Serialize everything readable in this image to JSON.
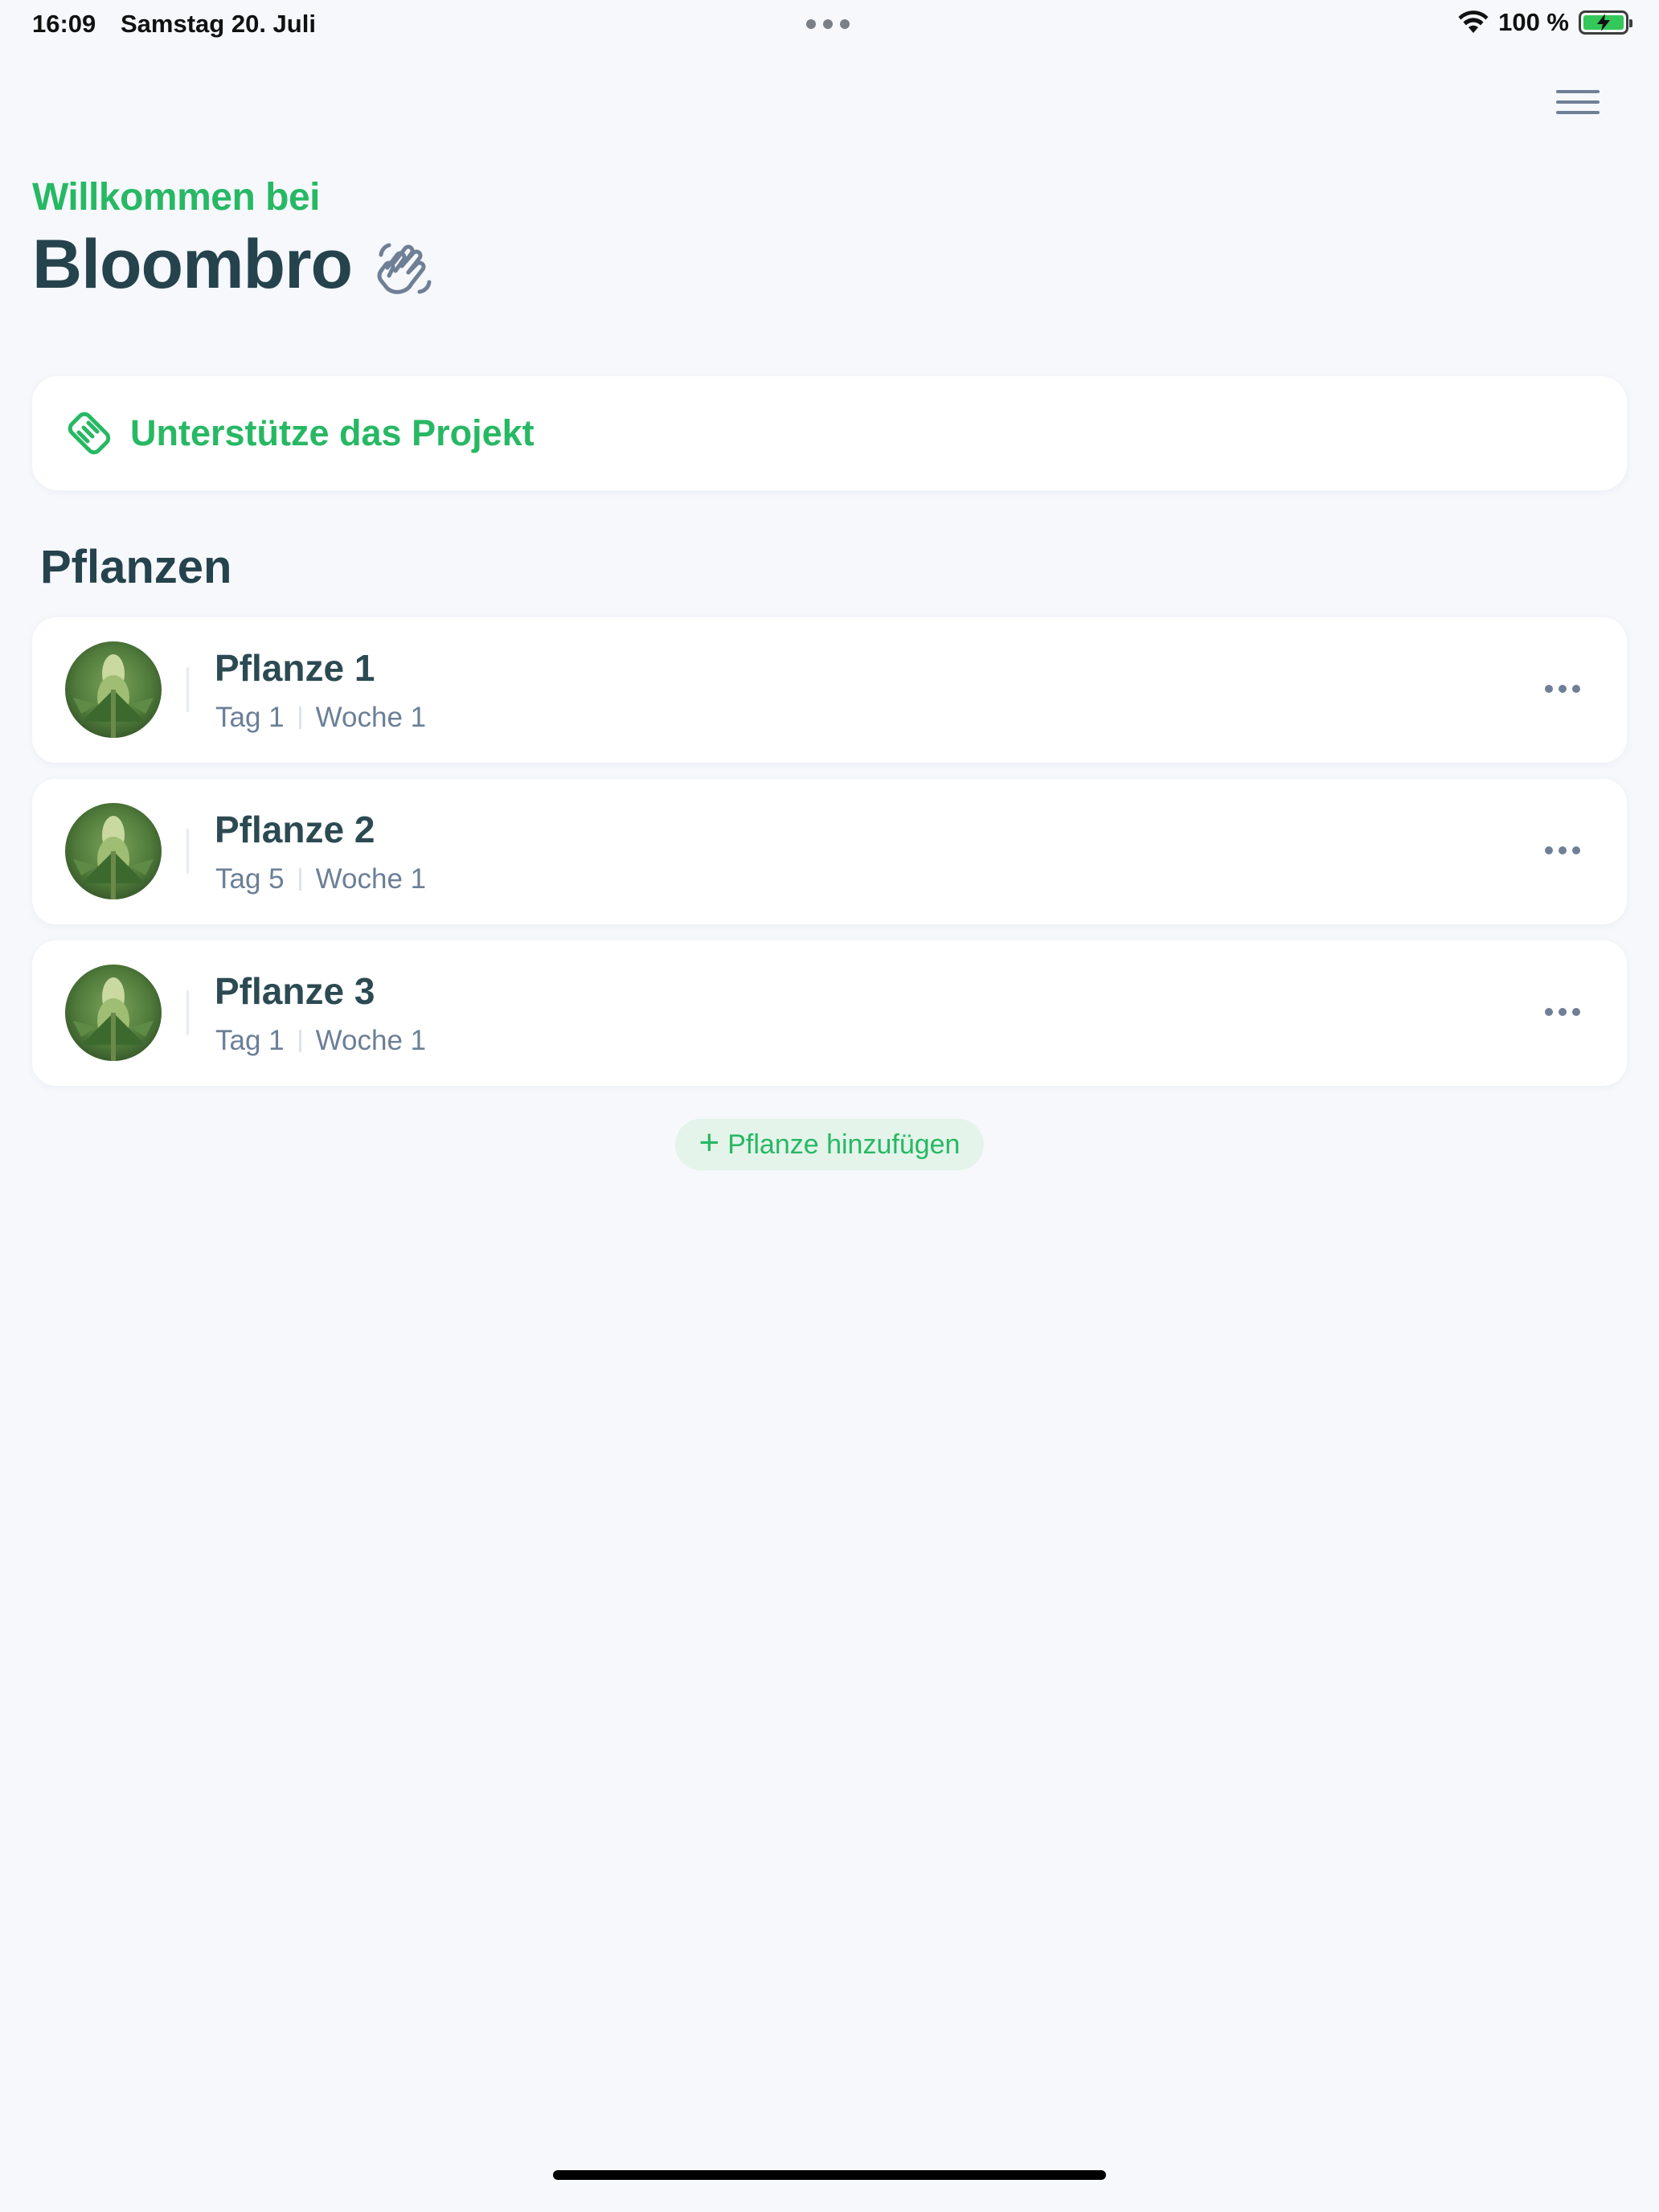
{
  "status_bar": {
    "time": "16:09",
    "date": "Samstag 20. Juli",
    "battery_percent": "100 %",
    "battery_level": 1.0,
    "charging": true,
    "wifi_icon": "wifi-icon"
  },
  "header": {
    "welcome": "Willkommen bei",
    "title": "Bloombro",
    "title_icon": "waving-hand-icon",
    "menu_icon": "hamburger-menu-icon"
  },
  "support": {
    "label": "Unterstütze das Projekt",
    "icon": "handshake-heart-icon"
  },
  "plants_section": {
    "title": "Pflanzen",
    "items": [
      {
        "name": "Pflanze 1",
        "day": "Tag 1",
        "week": "Woche 1"
      },
      {
        "name": "Pflanze 2",
        "day": "Tag 5",
        "week": "Woche 1"
      },
      {
        "name": "Pflanze 3",
        "day": "Tag 1",
        "week": "Woche 1"
      }
    ],
    "more_icon": "more-horizontal-icon",
    "add_label": "Pflanze hinzufügen",
    "add_icon": "plus-icon"
  },
  "colors": {
    "accent": "#27b864",
    "title": "#25434d",
    "muted": "#6b7f97",
    "background": "#f6f8fc",
    "card": "#ffffff"
  }
}
